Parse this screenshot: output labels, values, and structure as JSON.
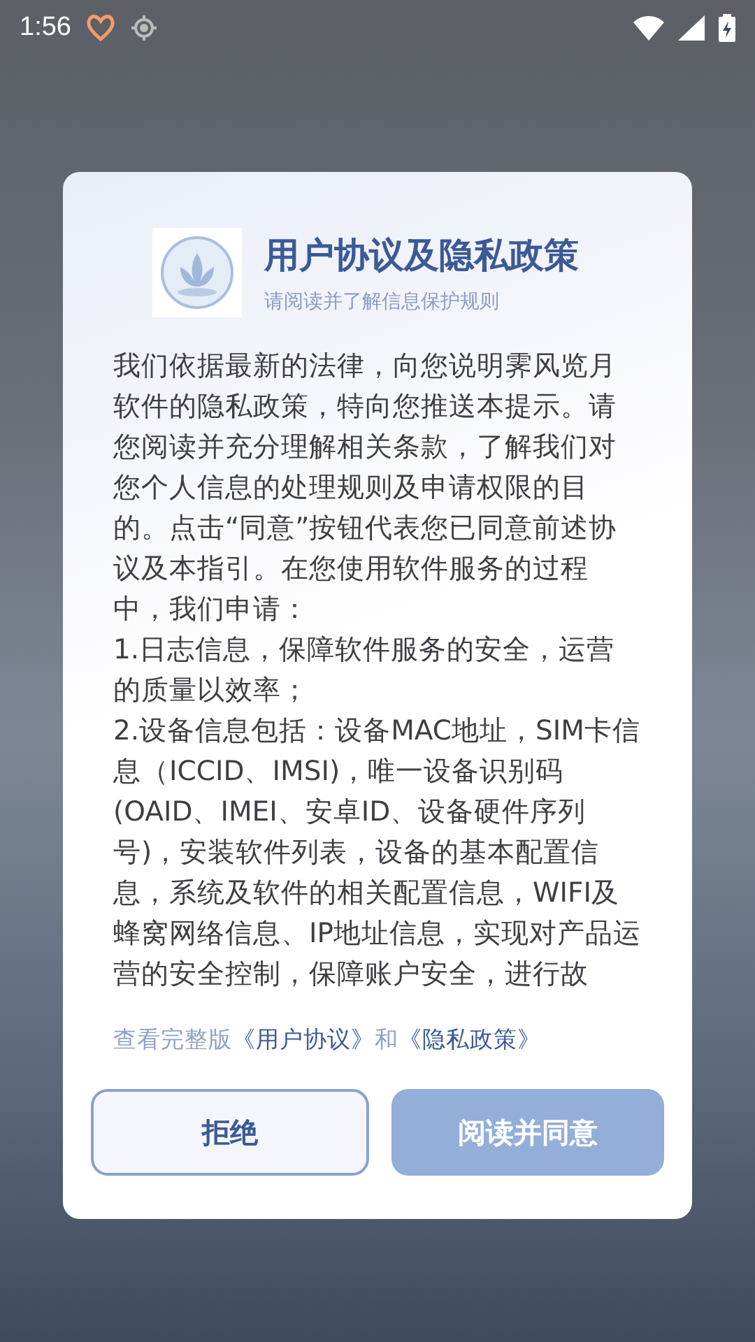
{
  "status_bar": {
    "time": "1:56"
  },
  "dialog": {
    "title": "用户协议及隐私政策",
    "subtitle": "请阅读并了解信息保护规则",
    "paragraphs": [
      "我们依据最新的法律，向您说明霁风览月软件的隐私政策，特向您推送本提示。请您阅读并充分理解相关条款，了解我们对您个人信息的处理规则及申请权限的目的。点击“同意”按钮代表您已同意前述协议及本指引。在您使用软件服务的过程中，我们申请：",
      "1.日志信息，保障软件服务的安全，运营的质量以效率；",
      "2.设备信息包括：设备MAC地址，SIM卡信息（ICCID、IMSI)，唯一设备识别码(OAID、IMEI、安卓ID、设备硬件序列号)，安装软件列表，设备的基本配置信息，系统及软件的相关配置信息，WIFI及蜂窝网络信息、IP地址信息，实现对产品运营的安全控制，保障账户安全，进行故"
    ],
    "links": [
      {
        "kind": "text",
        "text": "查看完整版"
      },
      {
        "kind": "link",
        "text": "《用户协议》"
      },
      {
        "kind": "text",
        "text": "和"
      },
      {
        "kind": "link",
        "text": "《隐私政策》"
      }
    ],
    "buttons": [
      {
        "kind": "outline",
        "label": "拒绝"
      },
      {
        "kind": "primary",
        "label": "阅读并同意"
      }
    ]
  }
}
